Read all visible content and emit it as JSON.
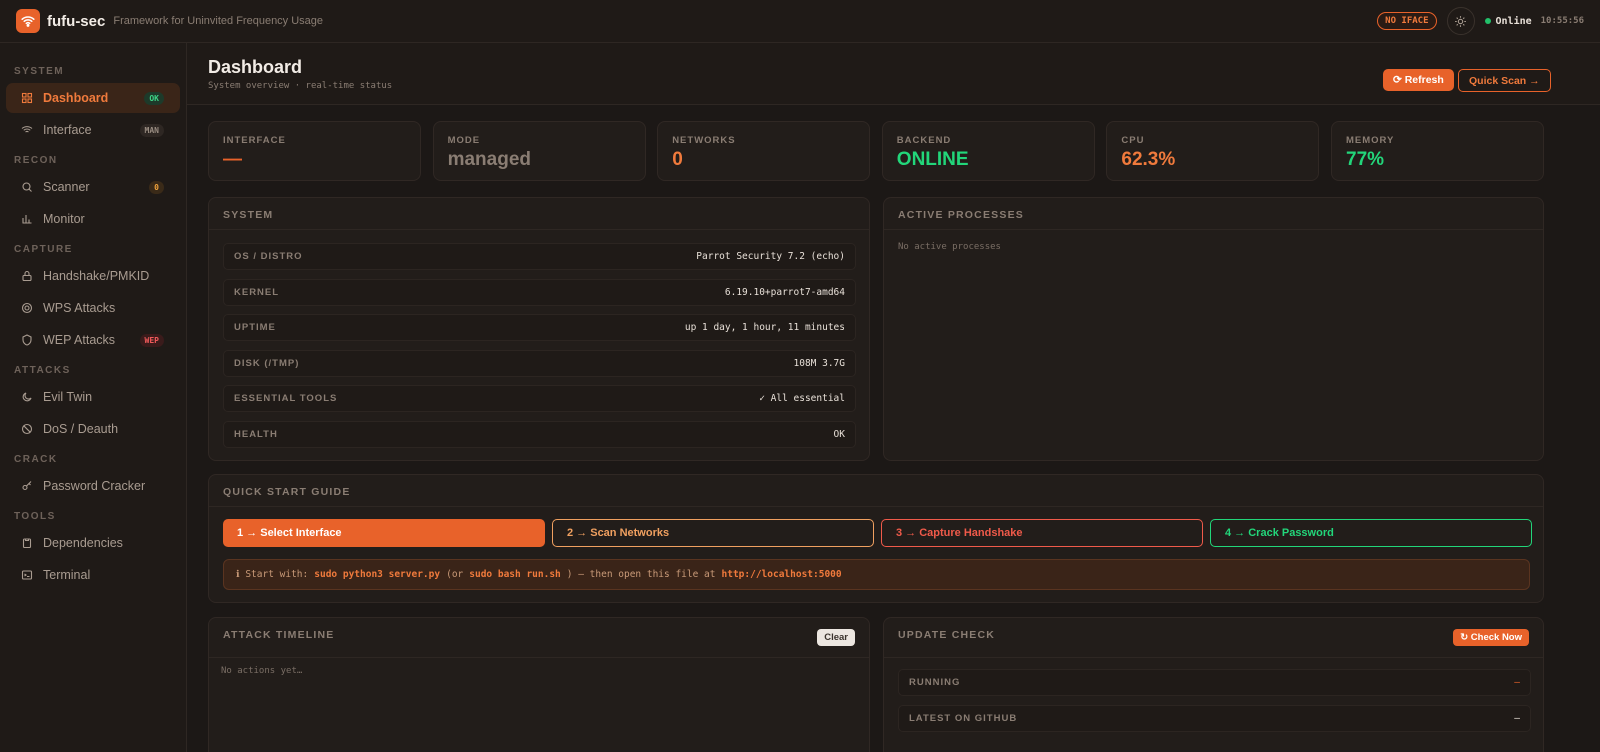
{
  "app": {
    "brand": "fufu-sec",
    "tagline": "Framework for Uninvited Frequency Usage",
    "iface_badge": "NO IFACE",
    "status": "Online",
    "clock": "10:55:56"
  },
  "sidebar": {
    "sections": [
      {
        "label": "SYSTEM",
        "items": [
          {
            "label": "Dashboard",
            "icon": "grid-icon",
            "badge": "OK",
            "active": true
          },
          {
            "label": "Interface",
            "icon": "wifi-icon",
            "badge": "MAN"
          }
        ]
      },
      {
        "label": "RECON",
        "items": [
          {
            "label": "Scanner",
            "icon": "search-icon",
            "badge": "0"
          },
          {
            "label": "Monitor",
            "icon": "bar-chart-icon"
          }
        ]
      },
      {
        "label": "CAPTURE",
        "items": [
          {
            "label": "Handshake/PMKID",
            "icon": "lock-icon"
          },
          {
            "label": "WPS Attacks",
            "icon": "target-icon"
          },
          {
            "label": "WEP Attacks",
            "icon": "shield-icon",
            "badge": "WEP"
          }
        ]
      },
      {
        "label": "ATTACKS",
        "items": [
          {
            "label": "Evil Twin",
            "icon": "moon-icon"
          },
          {
            "label": "DoS / Deauth",
            "icon": "ban-icon"
          }
        ]
      },
      {
        "label": "CRACK",
        "items": [
          {
            "label": "Password Cracker",
            "icon": "key-icon"
          }
        ]
      },
      {
        "label": "TOOLS",
        "items": [
          {
            "label": "Dependencies",
            "icon": "clipboard-icon"
          },
          {
            "label": "Terminal",
            "icon": "terminal-icon"
          }
        ]
      }
    ]
  },
  "page": {
    "title": "Dashboard",
    "subtitle": "System overview · real-time status",
    "refresh_label": "⟳ Refresh",
    "quick_scan_label": "Quick Scan →"
  },
  "stats": [
    {
      "label": "INTERFACE",
      "value": "—",
      "color": "#e8622a"
    },
    {
      "label": "MODE",
      "value": "managed",
      "color": "#8a7d73"
    },
    {
      "label": "NETWORKS",
      "value": "0",
      "color": "#f07a3c"
    },
    {
      "label": "BACKEND",
      "value": "ONLINE",
      "color": "#22d67a"
    },
    {
      "label": "CPU",
      "value": "62.3%",
      "color": "#f07a3c"
    },
    {
      "label": "MEMORY",
      "value": "77%",
      "color": "#22d67a"
    }
  ],
  "system": {
    "title": "SYSTEM",
    "rows": [
      {
        "k": "OS / DISTRO",
        "v": "Parrot Security 7.2 (echo)"
      },
      {
        "k": "KERNEL",
        "v": "6.19.10+parrot7-amd64"
      },
      {
        "k": "UPTIME",
        "v": "up 1 day, 1 hour, 11 minutes"
      },
      {
        "k": "DISK (/TMP)",
        "v": "108M 3.7G"
      },
      {
        "k": "ESSENTIAL TOOLS",
        "v": "✓ All essential"
      },
      {
        "k": "HEALTH",
        "v": "OK"
      }
    ]
  },
  "processes": {
    "title": "ACTIVE PROCESSES",
    "empty": "No active processes"
  },
  "guide": {
    "title": "QUICK START GUIDE",
    "steps": [
      {
        "label": "1 → Select Interface",
        "color": "#e8622a"
      },
      {
        "label": "2 → Scan Networks",
        "color": "#f0a060"
      },
      {
        "label": "3 → Capture Handshake",
        "color": "#f05a4a"
      },
      {
        "label": "4 → Crack Password",
        "color": "#22d67a"
      }
    ],
    "hint_prefix": "ℹ Start with:",
    "hint_cmd1": "sudo python3 server.py",
    "hint_mid": "(or",
    "hint_cmd2": "sudo bash run.sh",
    "hint_suffix": ") — then open this file at",
    "hint_url": "http://localhost:5000"
  },
  "timeline": {
    "title": "ATTACK TIMELINE",
    "clear_label": "Clear",
    "empty": "No actions yet…"
  },
  "update": {
    "title": "UPDATE CHECK",
    "check_label": "↻ Check Now",
    "rows": [
      {
        "k": "RUNNING",
        "v": "—"
      },
      {
        "k": "LATEST ON GITHUB",
        "v": "—"
      }
    ]
  }
}
